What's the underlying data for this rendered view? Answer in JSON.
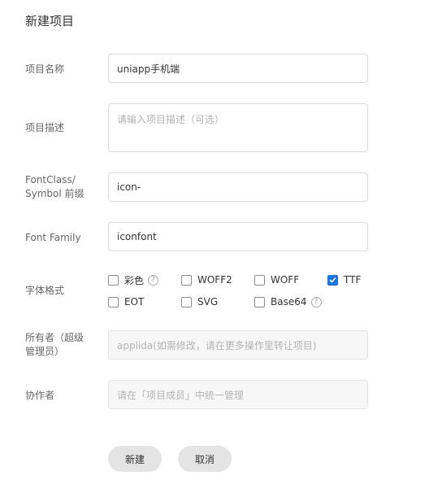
{
  "dialog": {
    "title": "新建项目"
  },
  "form": {
    "project_name": {
      "label": "项目名称",
      "value": "uniapp手机端"
    },
    "project_desc": {
      "label": "项目描述",
      "placeholder": "请输入项目描述（可选）"
    },
    "font_class": {
      "label_line1": "FontClass/",
      "label_line2": "Symbol 前缀",
      "value": "icon-"
    },
    "font_family": {
      "label": "Font Family",
      "value": "iconfont"
    },
    "font_format": {
      "label": "字体格式",
      "options": [
        {
          "label": "彩色",
          "checked": false,
          "help": "?"
        },
        {
          "label": "WOFF2",
          "checked": false
        },
        {
          "label": "WOFF",
          "checked": false
        },
        {
          "label": "TTF",
          "checked": true
        },
        {
          "label": "EOT",
          "checked": false
        },
        {
          "label": "SVG",
          "checked": false
        },
        {
          "label": "Base64",
          "checked": false,
          "help": "?"
        }
      ]
    },
    "owner": {
      "label_line1": "所有者（超级",
      "label_line2": "管理员）",
      "placeholder": "applida(如需修改，请在更多操作里转让项目)"
    },
    "collaborators": {
      "label": "协作者",
      "placeholder": "请在「项目成员」中统一管理"
    }
  },
  "buttons": {
    "create": "新建",
    "cancel": "取消"
  },
  "colors": {
    "accent": "#1a73e8",
    "button_bg": "#e4e4e4"
  }
}
